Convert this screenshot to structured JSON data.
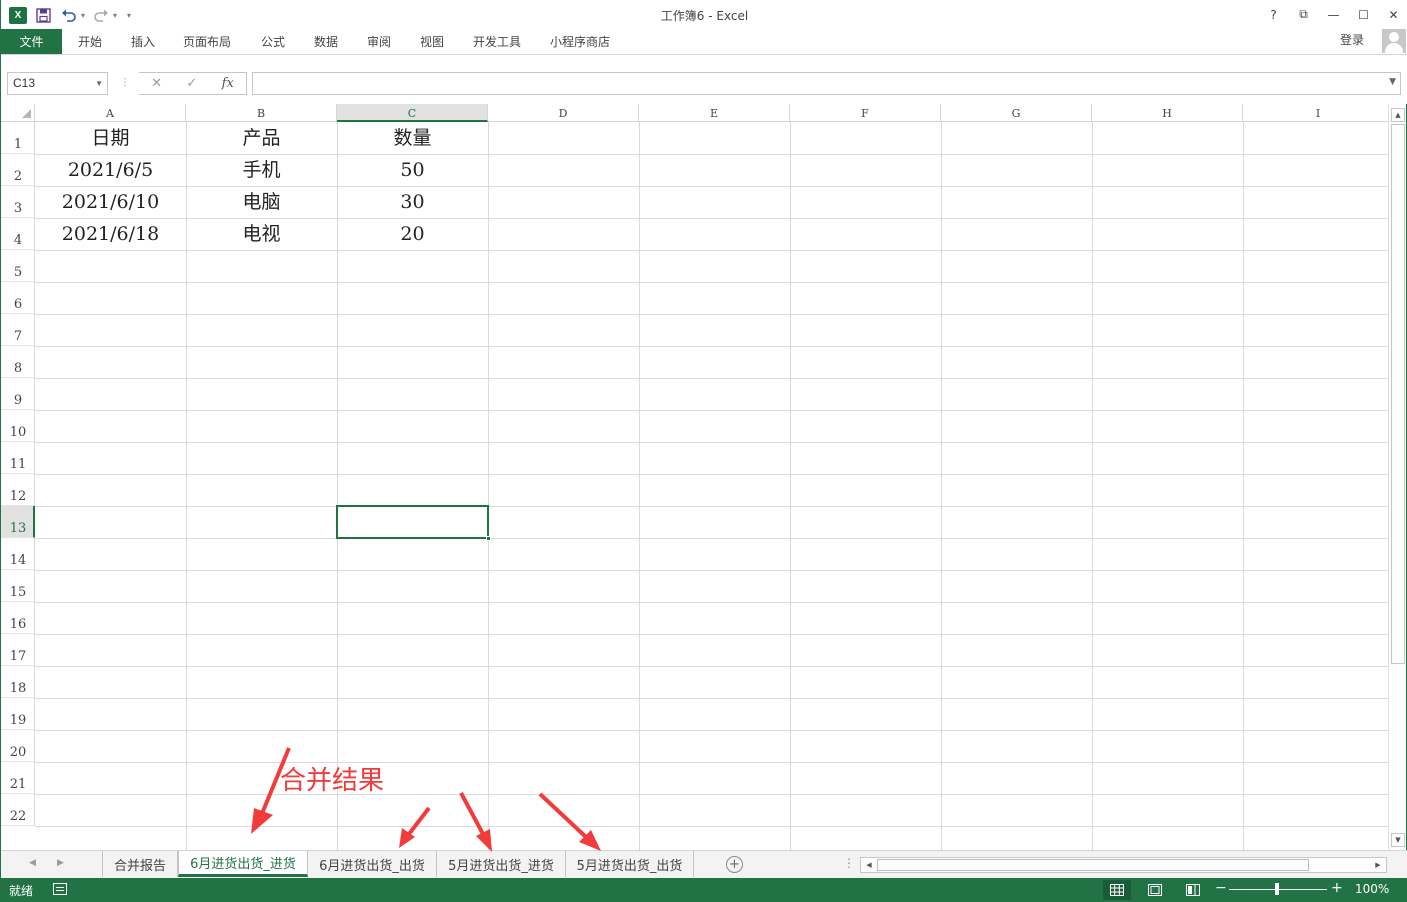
{
  "window": {
    "title": "工作簿6 - Excel",
    "app_icon_label": "X",
    "controls": [
      "?",
      "⧉",
      "—",
      "☐",
      "✕"
    ]
  },
  "ribbon": {
    "file_tab": "文件",
    "tabs": [
      "开始",
      "插入",
      "页面布局",
      "公式",
      "数据",
      "审阅",
      "视图",
      "开发工具",
      "小程序商店"
    ],
    "login": "登录"
  },
  "formula_bar": {
    "name_box": "C13",
    "formula": "",
    "fx_label": "fx"
  },
  "grid": {
    "columns": [
      "A",
      "B",
      "C",
      "D",
      "E",
      "F",
      "G",
      "H",
      "I"
    ],
    "rows": [
      "1",
      "2",
      "3",
      "4",
      "5",
      "6",
      "7",
      "8",
      "9",
      "10",
      "11",
      "12",
      "13",
      "14",
      "15",
      "16",
      "17",
      "18",
      "19",
      "20",
      "21",
      "22"
    ],
    "data": [
      [
        "日期",
        "产品",
        "数量"
      ],
      [
        "2021/6/5",
        "手机",
        "50"
      ],
      [
        "2021/6/10",
        "电脑",
        "30"
      ],
      [
        "2021/6/18",
        "电视",
        "20"
      ]
    ],
    "active_column": "C",
    "active_row": "13"
  },
  "annotation": {
    "text": "合并结果",
    "color": "#f23b3b"
  },
  "sheets": {
    "tabs": [
      "合并报告",
      "6月进货出货_进货",
      "6月进货出货_出货",
      "5月进货出货_进货",
      "5月进货出货_出货"
    ],
    "active_index": 1
  },
  "status": {
    "ready": "就绪",
    "zoom": "100%"
  },
  "colors": {
    "accent": "#217346",
    "annotation": "#f23b3b"
  }
}
